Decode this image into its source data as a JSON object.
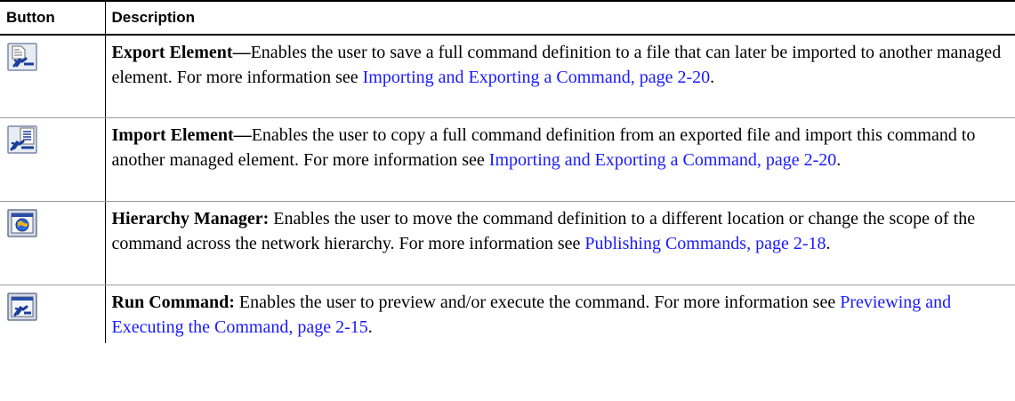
{
  "table": {
    "headers": {
      "button": "Button",
      "description": "Description"
    },
    "rows": [
      {
        "icon": "export-element-icon",
        "title": "Export Element—",
        "text": "Enables the user to save a full command definition to a file that can later be imported to another managed element. For more information see ",
        "link": "Importing and Exporting a Command, page 2-20",
        "end": "."
      },
      {
        "icon": "import-element-icon",
        "title": "Import Element—",
        "text": "Enables the user to copy a full command definition from an exported file and import this command to another managed element. For more information see ",
        "link": "Importing and Exporting a Command, page 2-20",
        "end": "."
      },
      {
        "icon": "hierarchy-manager-icon",
        "title": "Hierarchy Manager:",
        "text": " Enables the user to move the command definition to a different location or change the scope of the command across the network hierarchy. For more information see ",
        "link": "Publishing Commands, page 2-18",
        "end": "."
      },
      {
        "icon": "run-command-icon",
        "title": "Run Command:",
        "text": " Enables the user to preview and/or execute the command. For more information see ",
        "link": "Previewing and Executing the Command, page 2-15",
        "end": "."
      }
    ]
  },
  "colors": {
    "link": "#1a1aff",
    "text": "#000000",
    "rule": "#9a9a9a"
  }
}
